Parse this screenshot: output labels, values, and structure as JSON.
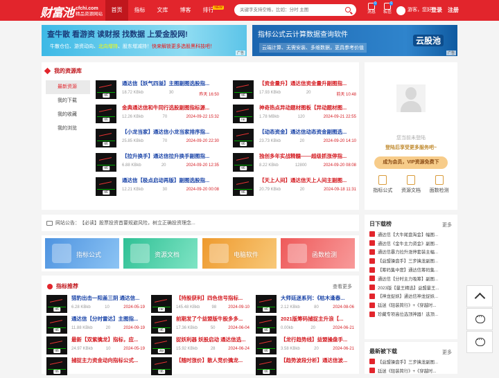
{
  "header": {
    "logo_text": "财富池",
    "logo_domain": "cfchi.com",
    "logo_slogan": "精品资源网站",
    "nav": [
      {
        "label": "首页",
        "active": true
      },
      {
        "label": "指标"
      },
      {
        "label": "文库"
      },
      {
        "label": "博客"
      },
      {
        "label": "排行",
        "badge": "NEW"
      }
    ],
    "search_placeholder": "关键字支持空格，比如：分时 主图",
    "messages": {
      "label": "消息",
      "count": "0"
    },
    "private_msg": {
      "label": "私信",
      "count": "0"
    },
    "greeting": "游客，您好！",
    "login": "登录",
    "register": "注册"
  },
  "banners": {
    "left": {
      "title": "查牛散 看游资 读财报 找数据 上爱金股网!",
      "subtitle_parts": [
        "牛散仓位、游资动向、",
        "北向增持",
        "、股东增减持！",
        "快来解锁更多选股黑科技吧！"
      ],
      "ad": "广告"
    },
    "right": {
      "title": "指标公式云计算数据查询软件",
      "subtitle": "云端计算、无需安装、多维数据，更具参考价值",
      "brand": "云股池",
      "ad": "广告"
    }
  },
  "my_resources": {
    "title": "我的资源库",
    "menu": [
      "最新资源",
      "我的下载",
      "我的收藏",
      "我的浏览"
    ],
    "items": [
      {
        "title": "通达信【妖气四溢】主图副图选股指...",
        "size": "18.72 KBkb",
        "views": "30",
        "date": "昨天 16:50",
        "tag": "tt6",
        "color": "blue"
      },
      {
        "title": "【资金量升】通达信资金量升副图指...",
        "size": "17.93 KBkb",
        "views": "20",
        "date": "前天 10:48",
        "tag": "tt6",
        "color": "red"
      },
      {
        "title": "金典通达信和牛同行选股副图指标源...",
        "size": "12.26 KBkb",
        "views": "70",
        "date": "2024-09-22 15:32",
        "tag": "tt6",
        "color": "red"
      },
      {
        "title": "神奇热点异动题材图板【异动题材图...",
        "size": "1.78 MBkb",
        "views": "120",
        "date": "2024-09-21 22:55",
        "tag": "rar",
        "color": "red"
      },
      {
        "title": "【小龙当家】通达信小龙当家排序指...",
        "size": "25.85 KBkb",
        "views": "70",
        "date": "2024-09-20 22:30",
        "tag": "tt6",
        "color": "blue"
      },
      {
        "title": "【动态资金】通达信动态资金副图选...",
        "size": "23.73 KBkb",
        "views": "20",
        "date": "2024-09-20 14:10",
        "tag": "tt6",
        "color": "blue"
      },
      {
        "title": "【拉升换手】通达信拉升换手副图指...",
        "size": "6.88 KBkb",
        "views": "20",
        "date": "2024-09-20 12:35",
        "tag": "tt6",
        "color": "blue"
      },
      {
        "title": "独创多年实战精髓——超级抓涨停指...",
        "size": "8.22 KBkb",
        "views": "12800",
        "date": "2024-09-20 08:08",
        "tag": "tt6",
        "color": "red"
      },
      {
        "title": "通达信【极点启动再版】副图选股指...",
        "size": "12.21 KBkb",
        "views": "30",
        "date": "2024-09-20 00:08",
        "tag": "tt6",
        "color": "blue"
      },
      {
        "title": "【天上人间】通达信天上人间主副图...",
        "size": "20.79 KBkb",
        "views": "20",
        "date": "2024-09-18 11:31",
        "tag": "tt6",
        "color": "red"
      }
    ]
  },
  "user_card": {
    "name": "您当前未登陆",
    "login_hint": "登陆后享受更多服务吧~",
    "vip_button": "成为会员，VIP资源免费下",
    "actions": [
      "指标公式",
      "资源文档",
      "面数检测"
    ]
  },
  "notice": {
    "label": "网站公告：",
    "text": "【必读】股票投资首要规避风险，树立正确投资理念..."
  },
  "categories": [
    {
      "label": "指标公式",
      "color": "#5aa0e6"
    },
    {
      "label": "资源文档",
      "color": "#3cc8a0"
    },
    {
      "label": "电脑软件",
      "color": "#f0a640"
    },
    {
      "label": "函数检测",
      "color": "#f06a6a"
    }
  ],
  "recommend": {
    "title": "指标推荐",
    "more": "查看更多",
    "items": [
      {
        "title": "猎豹出击一阳盖三阴 通达信...",
        "size": "6.28 KBkb",
        "views": "10",
        "date": "2024-05-19",
        "tag": "tt6",
        "color": "blue"
      },
      {
        "title": "【持股获利】四色信号指标...",
        "size": "145.48 KBkb",
        "views": "98",
        "date": "2024-09-10",
        "tag": "rar",
        "color": "red"
      },
      {
        "title": "大师廷迷系列：《枯木逢春...",
        "size": "2.12 KBkb",
        "views": "80",
        "date": "2024-08-06",
        "tag": "tt6",
        "color": "blue"
      },
      {
        "title": "通达信【分时雷达】主图指...",
        "size": "11.88 KBkb",
        "views": "20",
        "date": "2024-09-19",
        "tag": "tt6",
        "color": "blue"
      },
      {
        "title": "前期发了个益盟版牛股多多...",
        "size": "17.36 KBkb",
        "views": "50",
        "date": "2024-06-04",
        "tag": "tt6",
        "color": "red"
      },
      {
        "title": "2021版筹码捕捉主升浪【...",
        "size": "0.00kb",
        "views": "20",
        "date": "2024-06-21",
        "tag": "tt6",
        "color": "red"
      },
      {
        "title": "最新【双紫擒龙】指标，应...",
        "size": "24.97 KBkb",
        "views": "10",
        "date": "2024-05-19",
        "tag": "tt6",
        "color": "red"
      },
      {
        "title": "捉妖利器 妖股启动 通达信选...",
        "size": "15.92 KBkb",
        "views": "28",
        "date": "2024-06-24",
        "tag": "zip",
        "color": "red"
      },
      {
        "title": "【龙行趋势线】益盟操盘手...",
        "size": "3.58 KBkb",
        "views": "20",
        "date": "2024-06-21",
        "tag": "tt6",
        "color": "red"
      },
      {
        "title": "捕捉主力资金动向指标公式...",
        "size": "",
        "views": "",
        "date": "",
        "tag": "tt6",
        "color": "red"
      },
      {
        "title": "【随时涨价】散人竞价擒龙...",
        "size": "",
        "views": "",
        "date": "",
        "tag": "tt6",
        "color": "red"
      },
      {
        "title": "【趋势波段分析】通达信波...",
        "size": "",
        "views": "",
        "date": "",
        "tag": "tt6",
        "color": "red"
      }
    ]
  },
  "rank_today": {
    "title": "日下载榜",
    "more": "更多",
    "items": [
      "通达信【大牛尾盘淘金】幅图...",
      "通达信《金牛主力资金》副图...",
      "通达信暴力拉升涨停套装主幅...",
      "【益盟操盘手】三步擒龙副图...",
      "【筹码集中度】通达信筹码集...",
      "通达信【分时主力吸筹】副图...",
      "2023版【量王精选】益盟量王...",
      "【神龙捉妖】通达信神龙捉妖...",
      "廷迷《轻装简行》+《穿越时...",
      "珍藏专项高位选顶神器！选顶..."
    ]
  },
  "rank_latest": {
    "title": "最新被下载",
    "more": "更多",
    "items": [
      "【益盟操盘手】三步擒龙副图...",
      "廷迷《轻装简行》+《穿越时..."
    ]
  }
}
